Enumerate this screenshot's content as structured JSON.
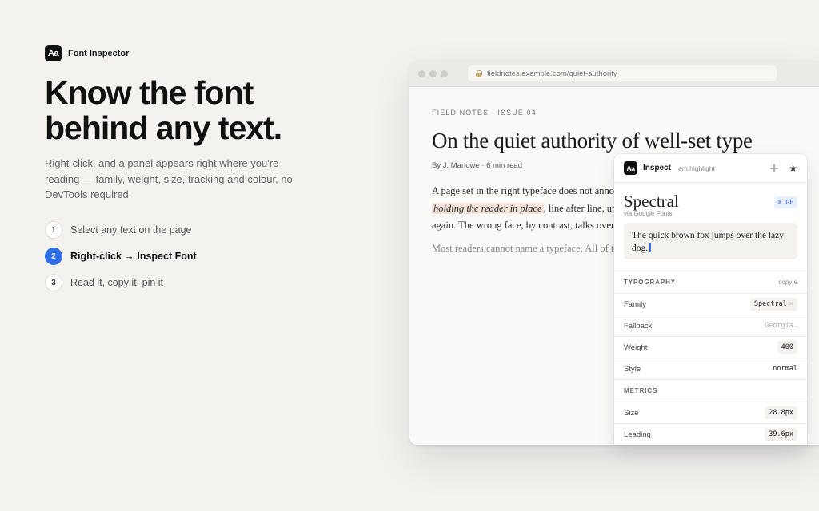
{
  "brand": {
    "logo": "Aa",
    "name": "Font Inspector"
  },
  "hero": {
    "headline_line1": "Know the font",
    "headline_line2": "behind any text.",
    "lede": "Right-click, and a panel appears right where you're reading — family, weight, size, tracking and colour, no DevTools required."
  },
  "steps": [
    {
      "num": "1",
      "label": "Select any text on the page"
    },
    {
      "num": "2",
      "label": "Right-click → Inspect Font"
    },
    {
      "num": "3",
      "label": "Read it, copy it, pin it"
    }
  ],
  "browser": {
    "url": "fieldnotes.example.com/quiet-authority",
    "kicker": "FIELD NOTES · ISSUE 04",
    "title": "On the quiet authority of well-set type",
    "byline": "By J. Marlowe · 6 min read",
    "para_line1": "A page set in the right typeface does not announce itself. It sits quietly,",
    "para_highlight": "holding the reader in place",
    "para_line2_rest": ", line after line, until the page is turned",
    "para_line3": "again. The wrong face, by contrast, talks over its own words.",
    "muted_line": "Most readers cannot name a typeface. All of them can feel one."
  },
  "inspector": {
    "logo": "Aa",
    "title": "Inspect",
    "selector": "em.highlight",
    "font_name": "Spectral",
    "badge": "⌘ GF",
    "source": "via Google Fonts",
    "sample": "The quick brown fox jumps over the lazy dog.",
    "typography_label": "TYPOGRAPHY",
    "copy_label": "copy e",
    "metrics_label": "METRICS",
    "typography": [
      {
        "name": "Family",
        "value": "Spectral"
      },
      {
        "name": "Fallback",
        "value": "Georgia…"
      },
      {
        "name": "Weight",
        "value": "400"
      },
      {
        "name": "Style",
        "value": "normal"
      }
    ],
    "metrics": [
      {
        "name": "Size",
        "value": "28.8px"
      },
      {
        "name": "Leading",
        "value": "39.6px"
      }
    ]
  },
  "colors": {
    "accent": "#2f6fe8",
    "highlight": "#f4e4da",
    "background": "#f3f2ef"
  },
  "icons": {
    "lock": "lock-icon",
    "move": "move-icon",
    "pin": "pin-icon"
  }
}
